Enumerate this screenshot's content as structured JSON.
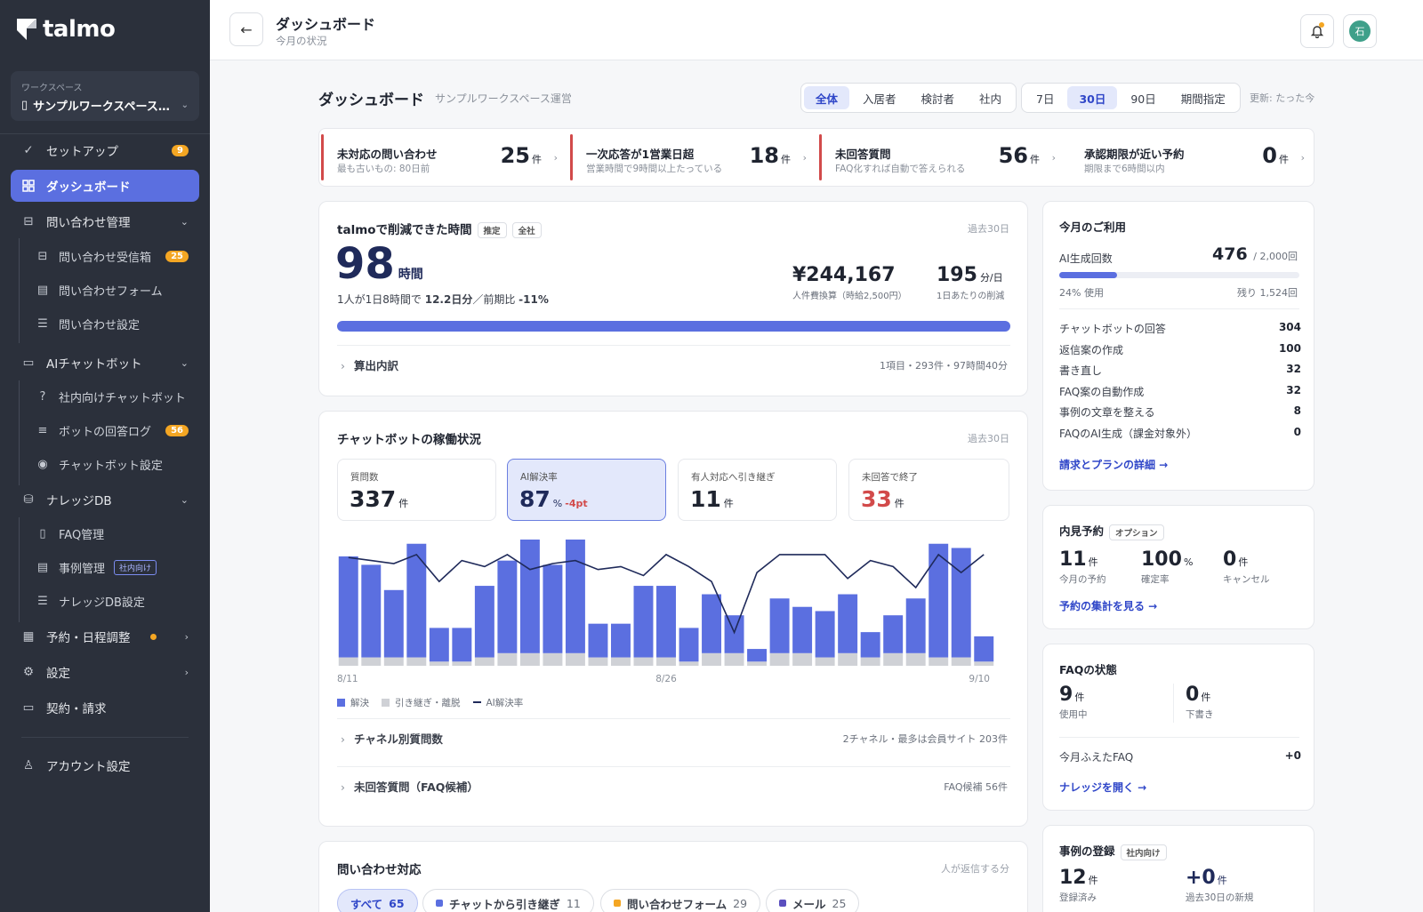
{
  "sidebar": {
    "brand": "talmo",
    "workspace_label": "ワークスペース",
    "workspace_name": "サンプルワークスペース…",
    "items": [
      {
        "label": "セットアップ",
        "badge": "9"
      },
      {
        "label": "ダッシュボード"
      },
      {
        "label": "問い合わせ管理"
      },
      {
        "label": "問い合わせ受信箱",
        "badge": "25"
      },
      {
        "label": "問い合わせフォーム"
      },
      {
        "label": "問い合わせ設定"
      },
      {
        "label": "AIチャットボット"
      },
      {
        "label": "社内向けチャットボット"
      },
      {
        "label": "ボットの回答ログ",
        "badge": "56"
      },
      {
        "label": "チャットボット設定"
      },
      {
        "label": "ナレッジDB"
      },
      {
        "label": "FAQ管理"
      },
      {
        "label": "事例管理",
        "tag": "社内向け"
      },
      {
        "label": "ナレッジDB設定"
      },
      {
        "label": "予約・日程調整"
      },
      {
        "label": "設定"
      },
      {
        "label": "契約・請求"
      },
      {
        "label": "アカウント設定"
      }
    ]
  },
  "header": {
    "title": "ダッシュボード",
    "subtitle": "今月の状況",
    "avatar_initial": "石"
  },
  "page": {
    "title": "ダッシュボード",
    "subtitle": "サンプルワークスペース運営",
    "scope_tabs": [
      "全体",
      "入居者",
      "検討者",
      "社内"
    ],
    "range_tabs": [
      "7日",
      "30日",
      "90日",
      "期間指定"
    ],
    "updated": "更新: たった今"
  },
  "alerts": [
    {
      "title": "未対応の問い合わせ",
      "sub": "最も古いもの: 80日前",
      "value": "25",
      "unit": "件",
      "flag": true
    },
    {
      "title": "一次応答が1営業日超",
      "sub": "営業時間で9時間以上たっている",
      "value": "18",
      "unit": "件",
      "flag": true
    },
    {
      "title": "未回答質問",
      "sub": "FAQ化すれば自動で答えられる",
      "value": "56",
      "unit": "件",
      "flag": true
    },
    {
      "title": "承認期限が近い予約",
      "sub": "期限まで6時間以内",
      "value": "0",
      "unit": "件",
      "flag": false
    }
  ],
  "savings": {
    "title": "talmoで削減できた時間",
    "pill1": "推定",
    "pill2": "全社",
    "period": "過去30日",
    "hours": "98",
    "hours_unit": "時間",
    "note_pre": "1人が1日8時間で ",
    "note_val": "12.2日分",
    "note_mid": "／前期比 ",
    "note_pct": "-11%",
    "cost": "¥244,167",
    "cost_caption": "人件費換算（時給2,500円）",
    "per_day": "195",
    "per_day_unit": "分/日",
    "per_day_caption": "1日あたりの削減",
    "progress": 1.0,
    "breakdown_label": "算出内訳",
    "breakdown_value": "1項目・293件・97時間40分"
  },
  "chatbot": {
    "title": "チャットボットの稼働状況",
    "period": "過去30日",
    "stats": [
      {
        "label": "質問数",
        "value": "337",
        "unit": "件",
        "delta": ""
      },
      {
        "label": "AI解決率",
        "value": "87",
        "unit": "%",
        "delta": "-4pt"
      },
      {
        "label": "有人対応へ引き継ぎ",
        "value": "11",
        "unit": "件",
        "delta": ""
      },
      {
        "label": "未回答で終了",
        "value": "33",
        "unit": "件",
        "delta": ""
      }
    ],
    "legend": [
      "解決",
      "引き継ぎ・離脱",
      "AI解決率"
    ],
    "channel_label": "チャネル別質問数",
    "channel_value": "2チャネル・最多は会員サイト 203件",
    "unanswered_label": "未回答質問（FAQ候補）",
    "unanswered_value": "FAQ候補 56件"
  },
  "chart_data": {
    "type": "bar",
    "x_tick_labels": [
      "8/11",
      "8/26",
      "9/10"
    ],
    "series": [
      {
        "name": "解決",
        "values": [
          24,
          22,
          16,
          27,
          8,
          8,
          17,
          22,
          27,
          21,
          27,
          8,
          8,
          17,
          17,
          8,
          14,
          9,
          3,
          13,
          11,
          11,
          14,
          6,
          9,
          13,
          27,
          26,
          6
        ]
      },
      {
        "name": "引き継ぎ・離脱",
        "values": [
          2,
          2,
          2,
          2,
          1,
          1,
          2,
          3,
          3,
          3,
          3,
          2,
          2,
          2,
          2,
          1,
          3,
          3,
          1,
          3,
          3,
          2,
          3,
          2,
          3,
          3,
          2,
          2,
          1
        ]
      },
      {
        "name": "AI解決率",
        "values": [
          94,
          93,
          92,
          95,
          86,
          93,
          91,
          95,
          90,
          92,
          93,
          90,
          91,
          88,
          95,
          91,
          86,
          69,
          89,
          95,
          95,
          95,
          87,
          93,
          91,
          84,
          95,
          89,
          95
        ]
      }
    ],
    "colors": {
      "resolved": "#5b6fe0",
      "handoff": "#cfd1d6",
      "rate": "#1f2a5a"
    }
  },
  "inquiries": {
    "title": "問い合わせ対応",
    "meta": "人が返信する分",
    "tabs": [
      {
        "label": "すべて",
        "count": "65"
      },
      {
        "label": "チャットから引き継ぎ",
        "count": "11"
      },
      {
        "label": "問い合わせフォーム",
        "count": "29"
      },
      {
        "label": "メール",
        "count": "25"
      }
    ]
  },
  "usage": {
    "title": "今月のご利用",
    "ai_label": "AI生成回数",
    "ai_value": "476",
    "ai_limit": "/ 2,000回",
    "progress": 0.24,
    "used": "24% 使用",
    "remaining": "残り 1,524回",
    "rows": [
      {
        "label": "チャットボットの回答",
        "value": "304"
      },
      {
        "label": "返信案の作成",
        "value": "100"
      },
      {
        "label": "書き直し",
        "value": "32"
      },
      {
        "label": "FAQ案の自動作成",
        "value": "32"
      },
      {
        "label": "事例の文章を整える",
        "value": "8"
      },
      {
        "label": "FAQのAI生成（課金対象外）",
        "value": "0"
      }
    ],
    "link": "請求とプランの詳細 →"
  },
  "viewing": {
    "title": "内見予約",
    "pill": "オプション",
    "stats": [
      {
        "value": "11",
        "unit": "件",
        "caption": "今月の予約"
      },
      {
        "value": "100",
        "unit": "%",
        "caption": "確定率"
      },
      {
        "value": "0",
        "unit": "件",
        "caption": "キャンセル"
      }
    ],
    "link": "予約の集計を見る →"
  },
  "faq": {
    "title": "FAQの状態",
    "stats": [
      {
        "value": "9",
        "unit": "件",
        "caption": "使用中"
      },
      {
        "value": "0",
        "unit": "件",
        "caption": "下書き"
      }
    ],
    "row_label": "今月ふえたFAQ",
    "row_value": "+0",
    "link": "ナレッジを開く →"
  },
  "cases": {
    "title": "事例の登録",
    "pill": "社内向け",
    "stats": [
      {
        "value": "12",
        "unit": "件",
        "caption": "登録済み"
      },
      {
        "value": "+0",
        "unit": "件",
        "caption": "過去30日の新規"
      }
    ]
  }
}
